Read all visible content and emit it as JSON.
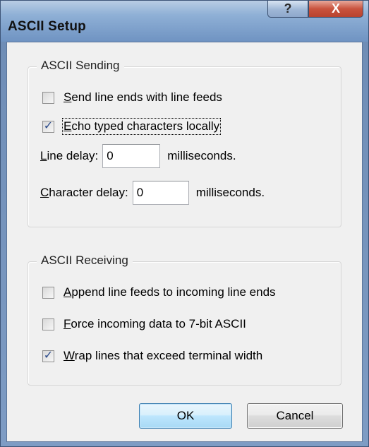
{
  "window": {
    "title": "ASCII Setup",
    "help_label": "?",
    "close_label": "X"
  },
  "sending": {
    "legend": "ASCII Sending",
    "send_line_ends": {
      "label_mnemonic": "S",
      "label_rest": "end line ends with line feeds",
      "checked": false
    },
    "echo_typed": {
      "label_mnemonic": "E",
      "label_rest": "cho typed characters locally",
      "checked": true
    },
    "line_delay": {
      "label_mnemonic": "L",
      "label_rest": "ine delay:",
      "value": "0",
      "unit": "milliseconds."
    },
    "char_delay": {
      "label_mnemonic": "C",
      "label_rest": "haracter delay:",
      "value": "0",
      "unit": "milliseconds."
    }
  },
  "receiving": {
    "legend": "ASCII Receiving",
    "append_line_feeds": {
      "label_mnemonic": "A",
      "label_rest": "ppend line feeds to incoming line ends",
      "checked": false
    },
    "force_7bit": {
      "label_mnemonic": "F",
      "label_rest": "orce incoming data to 7-bit ASCII",
      "checked": false
    },
    "wrap_lines": {
      "label_mnemonic": "W",
      "label_rest": "rap lines that exceed terminal width",
      "checked": true
    }
  },
  "buttons": {
    "ok_label": "OK",
    "cancel_label": "Cancel"
  }
}
